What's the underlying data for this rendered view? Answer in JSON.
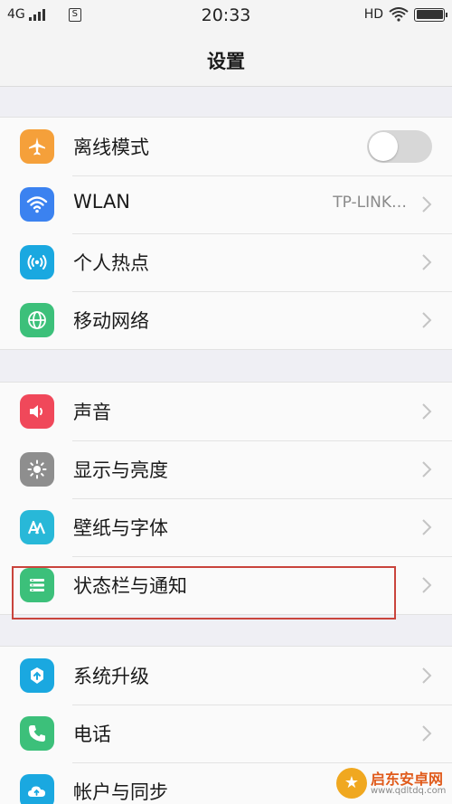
{
  "status_bar": {
    "network": "4G",
    "sim_label": "S",
    "time": "20:33",
    "hd": "HD"
  },
  "nav": {
    "title": "设置"
  },
  "groups": [
    {
      "items": [
        {
          "label": "离线模式",
          "icon": "airplane-icon",
          "icon_color": "#f5a03a",
          "toggle": "off"
        },
        {
          "label": "WLAN",
          "icon": "wifi-icon",
          "icon_color": "#3b82f0",
          "value": "TP-LINK…"
        },
        {
          "label": "个人热点",
          "icon": "hotspot-icon",
          "icon_color": "#1aa8e0"
        },
        {
          "label": "移动网络",
          "icon": "globe-icon",
          "icon_color": "#3cc07a"
        }
      ]
    },
    {
      "items": [
        {
          "label": "声音",
          "icon": "speaker-icon",
          "icon_color": "#f0485a"
        },
        {
          "label": "显示与亮度",
          "icon": "brightness-icon",
          "icon_color": "#8e8e8e"
        },
        {
          "label": "壁纸与字体",
          "icon": "font-icon",
          "icon_color": "#28b8d8"
        },
        {
          "label": "状态栏与通知",
          "icon": "statusbar-icon",
          "icon_color": "#3cc07a"
        }
      ]
    },
    {
      "items": [
        {
          "label": "系统升级",
          "icon": "upgrade-icon",
          "icon_color": "#1aa8e0"
        },
        {
          "label": "电话",
          "icon": "phone-icon",
          "icon_color": "#3cc07a"
        },
        {
          "label": "帐户与同步",
          "icon": "cloud-icon",
          "icon_color": "#1aa8e0"
        }
      ]
    }
  ],
  "watermark": {
    "text": "启东安卓网",
    "url": "www.qdltdq.com"
  }
}
